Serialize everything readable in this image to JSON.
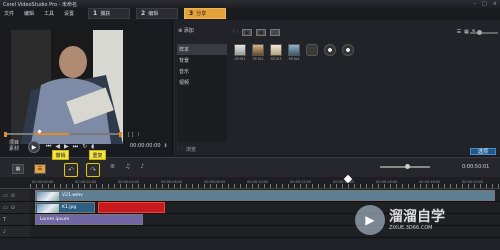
{
  "app": {
    "title": "Corel VideoStudio Pro - 未命名"
  },
  "menu": {
    "items": [
      "文件",
      "编辑",
      "工具",
      "设置"
    ]
  },
  "steps": [
    {
      "num": "1",
      "label": "捕获"
    },
    {
      "num": "2",
      "label": "编辑"
    },
    {
      "num": "3",
      "label": "分享"
    }
  ],
  "player": {
    "mode_labels": [
      "项目",
      "素材"
    ],
    "timecode": "00:00:00:00",
    "scrub_icons": "[ ]"
  },
  "library": {
    "add_label": "添加",
    "folders": [
      "样本",
      "背景",
      "音乐",
      "视频"
    ],
    "thumbs": [
      "SP-I01",
      "SP-I02",
      "SP-I03",
      "SP-I04",
      "",
      "",
      ""
    ],
    "browse_label": "浏览",
    "options_label": "选项"
  },
  "callouts": {
    "undo": "撤销",
    "redo": "重复"
  },
  "timeline": {
    "duration": "0:00:50:01",
    "ruler": [
      "00:00:00:00",
      "00:00:02:00",
      "00:00:04:00",
      "00:00:06:00",
      "00:00:08:00",
      "00:00:10:00",
      "00:00:12:00",
      "00:00:14:00",
      "00:00:16:00",
      "00:00:18:00",
      "00:00:20:00"
    ],
    "clips": {
      "video": "V21.wmv",
      "overlay": "K1.jpg",
      "title": "Lorem ipsum"
    }
  },
  "watermark": {
    "text": "溜溜自学",
    "sub": "ZIXUE.3D66.COM"
  },
  "colors": {
    "accent": "#e6a23a",
    "highlight": "#f5e44a",
    "red_clip": "#c8191c"
  }
}
